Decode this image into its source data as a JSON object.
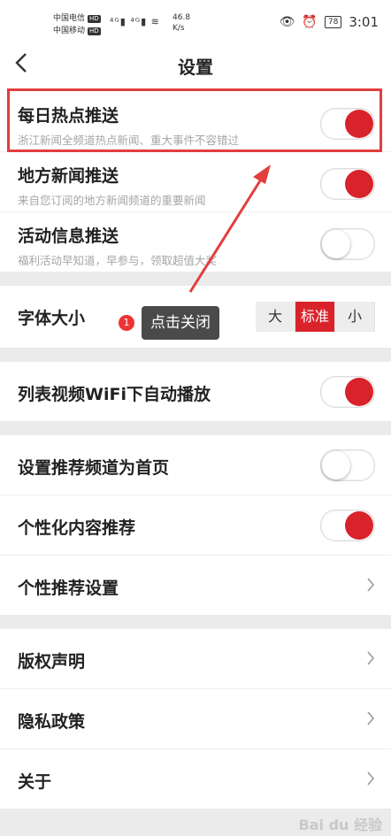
{
  "status_bar": {
    "carrier1": "中国电信",
    "carrier2": "中国移动",
    "hd": "HD",
    "speed_value": "46.8",
    "speed_unit": "K/s",
    "battery": "78",
    "time": "3:01"
  },
  "nav": {
    "title": "设置"
  },
  "push": [
    {
      "label": "每日热点推送",
      "desc": "浙江新闻全频道热点新闻、重大事件不容错过",
      "on": true
    },
    {
      "label": "地方新闻推送",
      "desc": "来自您订阅的地方新闻频道的重要新闻",
      "on": true
    },
    {
      "label": "活动信息推送",
      "desc": "福利活动早知道，早参与，领取超值大奖",
      "on": false
    }
  ],
  "font_size": {
    "label": "字体大小",
    "options": [
      "大",
      "标准",
      "小"
    ],
    "selected": "标准"
  },
  "video": {
    "label": "列表视频WiFi下自动播放",
    "on": true
  },
  "recommend": [
    {
      "label": "设置推荐频道为首页",
      "type": "toggle",
      "on": false
    },
    {
      "label": "个性化内容推荐",
      "type": "toggle",
      "on": true
    },
    {
      "label": "个性推荐设置",
      "type": "link"
    }
  ],
  "about": [
    {
      "label": "版权声明"
    },
    {
      "label": "隐私政策"
    },
    {
      "label": "关于"
    }
  ],
  "annotation": {
    "badge": "1",
    "callout": "点击关闭"
  },
  "watermark": "Bai du 经验",
  "colors": {
    "accent": "#d9232b",
    "highlight": "#e23e3e"
  }
}
